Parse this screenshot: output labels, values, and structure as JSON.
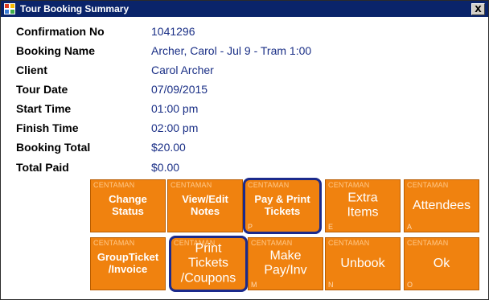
{
  "window": {
    "title": "Tour Booking Summary",
    "close_label": "X"
  },
  "details": [
    {
      "label": "Confirmation No",
      "value": "1041296"
    },
    {
      "label": "Booking Name",
      "value": "Archer, Carol - Jul  9 - Tram 1:00"
    },
    {
      "label": "Client",
      "value": "Carol Archer"
    },
    {
      "label": "Tour Date",
      "value": "07/09/2015"
    },
    {
      "label": "Start Time",
      "value": "01:00 pm"
    },
    {
      "label": "Finish Time",
      "value": "02:00 pm"
    },
    {
      "label": "Booking Total",
      "value": "$20.00"
    },
    {
      "label": "Total Paid",
      "value": "$0.00"
    }
  ],
  "buttons": [
    {
      "brand": "CENTAMAN",
      "label": "Change\nStatus",
      "key": ""
    },
    {
      "brand": "CENTAMAN",
      "label": "View/Edit\nNotes",
      "key": ""
    },
    {
      "brand": "CENTAMAN",
      "label": "Pay & Print\nTickets",
      "key": "P"
    },
    {
      "brand": "CENTAMAN",
      "label": "Extra\nItems",
      "key": "E"
    },
    {
      "brand": "CENTAMAN",
      "label": "Attendees",
      "key": "A"
    },
    {
      "brand": "CENTAMAN",
      "label": "GroupTicket\n/Invoice",
      "key": ""
    },
    {
      "brand": "CENTAMAN",
      "label": "Print\nTickets\n/Coupons",
      "key": ""
    },
    {
      "brand": "CENTAMAN",
      "label": "Make\nPay/Inv",
      "key": "M"
    },
    {
      "brand": "CENTAMAN",
      "label": "Unbook",
      "key": "N"
    },
    {
      "brand": "CENTAMAN",
      "label": "Ok",
      "key": "O"
    }
  ],
  "colors": {
    "button": "#f0820f",
    "title_bar": "#0a246a",
    "value_text": "#1a2f86",
    "highlight": "#1b2a8c"
  }
}
